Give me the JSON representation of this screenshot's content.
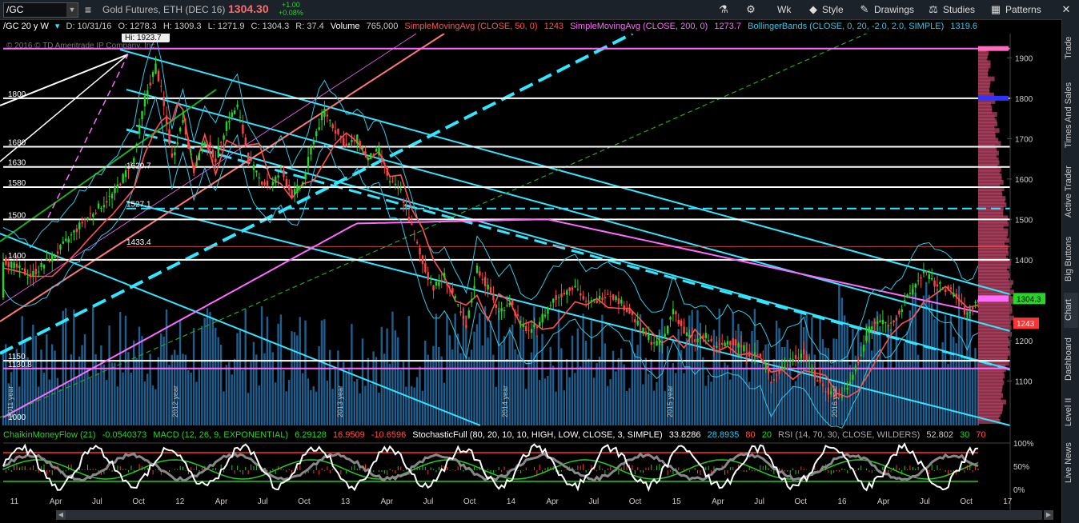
{
  "toolbar": {
    "symbol": "/GC",
    "description": "Gold Futures, ETH (DEC 16)",
    "price": "1304.30",
    "change": "+1.00",
    "change_pct": "+0.08%",
    "interval": "Wk",
    "style_label": "Style",
    "drawings_label": "Drawings",
    "studies_label": "Studies",
    "patterns_label": "Patterns"
  },
  "info_bar": {
    "period": "/GC 20 y W",
    "date": "D: 10/31/16",
    "open": "O: 1278.3",
    "high": "H: 1309.3",
    "low": "L: 1271.9",
    "close": "C: 1304.3",
    "range": "R: 37.4",
    "volume_label": "Volume",
    "volume_value": "765,000",
    "sma50_label": "SimpleMovingAvg (CLOSE, 50, 0)",
    "sma50_value": "1243",
    "sma200_label": "SimpleMovingAvg (CLOSE, 200, 0)",
    "sma200_value": "1273.7",
    "bb_label": "BollingerBands (CLOSE, 0, 20, -2.0, 2.0, SIMPLE)",
    "bb_value": "1319.6"
  },
  "chart_labels": {
    "high_marker": "Hi: 1923.7",
    "copyright": "© 2016 © TD Ameritrade IP Company, Inc.",
    "price_badge": "1304.3",
    "sma_badge": "1243",
    "level_labels": [
      {
        "text": "1800",
        "v": 1800
      },
      {
        "text": "1680",
        "v": 1680
      },
      {
        "text": "1630",
        "v": 1630
      },
      {
        "text": "1580",
        "v": 1580
      },
      {
        "text": "1500",
        "v": 1500
      },
      {
        "text": "1400",
        "v": 1400
      },
      {
        "text": "1150",
        "v": 1150
      },
      {
        "text": "1000",
        "v": 1000
      },
      {
        "text": "1527.1",
        "v": 1527
      },
      {
        "text": "1433.4",
        "v": 1433
      },
      {
        "text": "1620.7",
        "v": 1622
      },
      {
        "text": "1130.8",
        "v": 1131
      }
    ],
    "year_markers": [
      "2011 year",
      "2012 year",
      "2013 year",
      "2014 year",
      "2015 year",
      "2016 year"
    ]
  },
  "lower_info": {
    "cmf_label": "ChaikinMoneyFlow (21)",
    "cmf_value": "-0.0540373",
    "macd_label": "MACD (12, 26, 9, EXPONENTIAL)",
    "macd_v1": "6.29128",
    "macd_v2": "16.9509",
    "macd_v3": "-10.6596",
    "stoch_label": "StochasticFull (80, 20, 10, 10, HIGH, LOW, CLOSE, 3, SIMPLE)",
    "stoch_v1": "33.8286",
    "stoch_v2": "28.8935",
    "stoch_v3": "80",
    "stoch_v4": "20",
    "rsi_label": "RSI (14, 70, 30, CLOSE, WILDERS)",
    "rsi_v1": "52.802",
    "rsi_v2": "30",
    "rsi_v3": "70"
  },
  "right_tabs": [
    "Trade",
    "Times And Sales",
    "Active Trader",
    "Big Buttons",
    "Chart",
    "Dashboard",
    "Level II",
    "Live News"
  ],
  "chart_data": {
    "type": "candlestick",
    "y_axis_ticks": [
      1900,
      1800,
      1700,
      1600,
      1500,
      1400,
      1300,
      1200,
      1100
    ],
    "ylim": [
      990,
      1960
    ],
    "x_axis_ticks": [
      "11",
      "Apr",
      "Jul",
      "Oct",
      "12",
      "Apr",
      "Jul",
      "Oct",
      "13",
      "Apr",
      "Jul",
      "Oct",
      "14",
      "Apr",
      "Jul",
      "Oct",
      "15",
      "Apr",
      "Jul",
      "Oct",
      "16",
      "Apr",
      "Jul",
      "Oct",
      "17"
    ],
    "lower_y_ticks": [
      "100%",
      "50%",
      "0%"
    ],
    "close_path": [
      [
        0,
        1400
      ],
      [
        10,
        1360
      ],
      [
        20,
        1420
      ],
      [
        30,
        1500
      ],
      [
        40,
        1560
      ],
      [
        48,
        1650
      ],
      [
        52,
        1800
      ],
      [
        56,
        1880
      ],
      [
        58,
        1820
      ],
      [
        62,
        1650
      ],
      [
        66,
        1750
      ],
      [
        70,
        1620
      ],
      [
        74,
        1700
      ],
      [
        78,
        1650
      ],
      [
        82,
        1740
      ],
      [
        86,
        1780
      ],
      [
        90,
        1650
      ],
      [
        94,
        1600
      ],
      [
        98,
        1580
      ],
      [
        102,
        1620
      ],
      [
        106,
        1560
      ],
      [
        110,
        1590
      ],
      [
        114,
        1700
      ],
      [
        118,
        1770
      ],
      [
        122,
        1720
      ],
      [
        126,
        1680
      ],
      [
        130,
        1700
      ],
      [
        134,
        1650
      ],
      [
        138,
        1670
      ],
      [
        142,
        1590
      ],
      [
        146,
        1570
      ],
      [
        150,
        1480
      ],
      [
        154,
        1390
      ],
      [
        158,
        1330
      ],
      [
        162,
        1360
      ],
      [
        166,
        1300
      ],
      [
        170,
        1230
      ],
      [
        174,
        1380
      ],
      [
        178,
        1330
      ],
      [
        182,
        1270
      ],
      [
        186,
        1300
      ],
      [
        190,
        1240
      ],
      [
        194,
        1220
      ],
      [
        198,
        1260
      ],
      [
        202,
        1300
      ],
      [
        206,
        1320
      ],
      [
        210,
        1340
      ],
      [
        214,
        1290
      ],
      [
        218,
        1300
      ],
      [
        222,
        1320
      ],
      [
        226,
        1300
      ],
      [
        230,
        1270
      ],
      [
        234,
        1230
      ],
      [
        238,
        1200
      ],
      [
        242,
        1190
      ],
      [
        246,
        1280
      ],
      [
        250,
        1220
      ],
      [
        254,
        1200
      ],
      [
        258,
        1210
      ],
      [
        262,
        1180
      ],
      [
        266,
        1200
      ],
      [
        270,
        1190
      ],
      [
        274,
        1170
      ],
      [
        278,
        1160
      ],
      [
        282,
        1100
      ],
      [
        286,
        1130
      ],
      [
        290,
        1160
      ],
      [
        294,
        1170
      ],
      [
        298,
        1110
      ],
      [
        302,
        1080
      ],
      [
        306,
        1060
      ],
      [
        310,
        1080
      ],
      [
        314,
        1150
      ],
      [
        318,
        1230
      ],
      [
        322,
        1250
      ],
      [
        326,
        1240
      ],
      [
        330,
        1280
      ],
      [
        334,
        1330
      ],
      [
        338,
        1370
      ],
      [
        342,
        1340
      ],
      [
        346,
        1330
      ],
      [
        350,
        1310
      ],
      [
        354,
        1260
      ],
      [
        358,
        1304
      ]
    ],
    "horizontal_levels": [
      {
        "v": 1923,
        "color": "#ff6bff"
      },
      {
        "v": 1800,
        "color": "#ffffff"
      },
      {
        "v": 1680,
        "color": "#ffffff"
      },
      {
        "v": 1630,
        "color": "#ffffff"
      },
      {
        "v": 1580,
        "color": "#ffffff"
      },
      {
        "v": 1500,
        "color": "#ffffff"
      },
      {
        "v": 1400,
        "color": "#ffffff"
      },
      {
        "v": 1150,
        "color": "#ffffff"
      },
      {
        "v": 1131,
        "color": "#ff6bff"
      }
    ],
    "dashed_levels": [
      {
        "v": 1527,
        "color": "#33e6ff"
      }
    ],
    "thin_levels": [
      {
        "v": 1433,
        "color": "#ff6060"
      }
    ],
    "colors": {
      "up": "#28d428",
      "down": "#ff4444",
      "bb": "#33c7e6",
      "sma50": "#ff5050",
      "sma200": "#ff6bff",
      "volume": "#1f5f8f",
      "channel": "#33e6ff"
    }
  }
}
